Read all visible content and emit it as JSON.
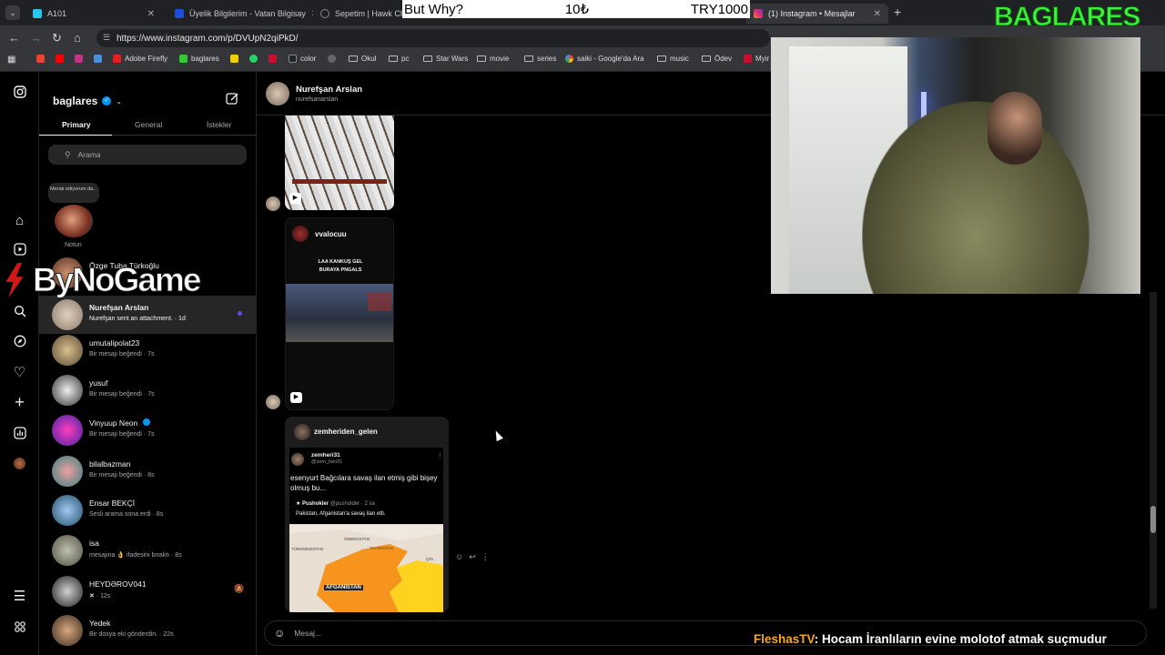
{
  "browser": {
    "tabs": [
      {
        "label": "A101",
        "color": "#2ec4f0"
      },
      {
        "label": "Üyelik Bilgilerim - Vatan Bilgisay",
        "color": "#1a4fd8"
      },
      {
        "label": "Sepetim | Hawk Char",
        "color": "#888888"
      },
      {
        "label": "(1) Instagram • Mesajlar",
        "color": "#e1306c"
      }
    ],
    "url": "https://www.instagram.com/p/DVUpN2qiPkD/",
    "bookmarks": [
      "Adobe Firefly",
      "baglares",
      "color",
      "Okul",
      "pc",
      "Star Wars",
      "movie",
      "series",
      "saiki - Google'da Ara",
      "music",
      "Ödev",
      "Myir"
    ]
  },
  "overlay_bar": {
    "left": "But Why?",
    "middle": "10₺",
    "right": "TRY1000"
  },
  "brand": "BAGLARES",
  "sponsor": "ByNoGame",
  "ticker": {
    "user": "FleshasTV",
    "message": ": Hocam İranlıların evine molotof atmak suçmudur"
  },
  "inbox": {
    "username": "baglares",
    "tabs": [
      "Primary",
      "General",
      "İstekler"
    ],
    "search_placeholder": "Arama",
    "note_bubble": "Merak ediyorum da...",
    "note_label": "Notun",
    "threads": [
      {
        "name": "Özge Tuba Türkoğlu",
        "sub": ""
      },
      {
        "name": "Nurefşan Arslan",
        "sub": "Nurefşan sent an attachment. · 1d"
      },
      {
        "name": "umutalipolat23",
        "sub": "Bir mesajı beğendi · 7s"
      },
      {
        "name": "yusuf",
        "sub": "Bir mesajı beğendi · 7s"
      },
      {
        "name": "Vinyuup Neon",
        "sub": "Bir mesajı beğendi · 7s"
      },
      {
        "name": "bilalbazman",
        "sub": "Bir mesajı beğendi · 8s"
      },
      {
        "name": "Ensar BEKÇİ",
        "sub": "Sesli arama sona erdi · 8s"
      },
      {
        "name": "isa",
        "sub": "mesajına 👌 ifadesini bıraktı · 8s"
      },
      {
        "name": "HEYDƏROV041",
        "sub": "✖ · 12s"
      },
      {
        "name": "Yedek",
        "sub": "Bir dosya eki gönderdin. · 22s"
      }
    ]
  },
  "chat": {
    "name": "Nurefşan Arslan",
    "handle": "nurefsanarslan",
    "post2_user": "vvalocuu",
    "post2_caption": "LAA KANKUŞ GEL BURAYA PNGALS",
    "post3_user": "zemheriden_gelen",
    "tweet_name": "zemheri31",
    "tweet_handle": "@zem_heri31",
    "tweet_text": "esenyurt Bağcılara savaş ilan etmiş gibi bişey olmuş bu...",
    "quote_name": "Pushokler",
    "quote_handle": "@pusholder · 2 sa",
    "quote_text": "Pakistan, Afganistan'a savaş ilan etti.",
    "map_labels": [
      "ÖZBEKİSTAN",
      "TACİKİSTAN",
      "TÜRKMENİSTAN",
      "ÇİN",
      "AFGANİSTAN"
    ],
    "input_placeholder": "Mesaj..."
  }
}
